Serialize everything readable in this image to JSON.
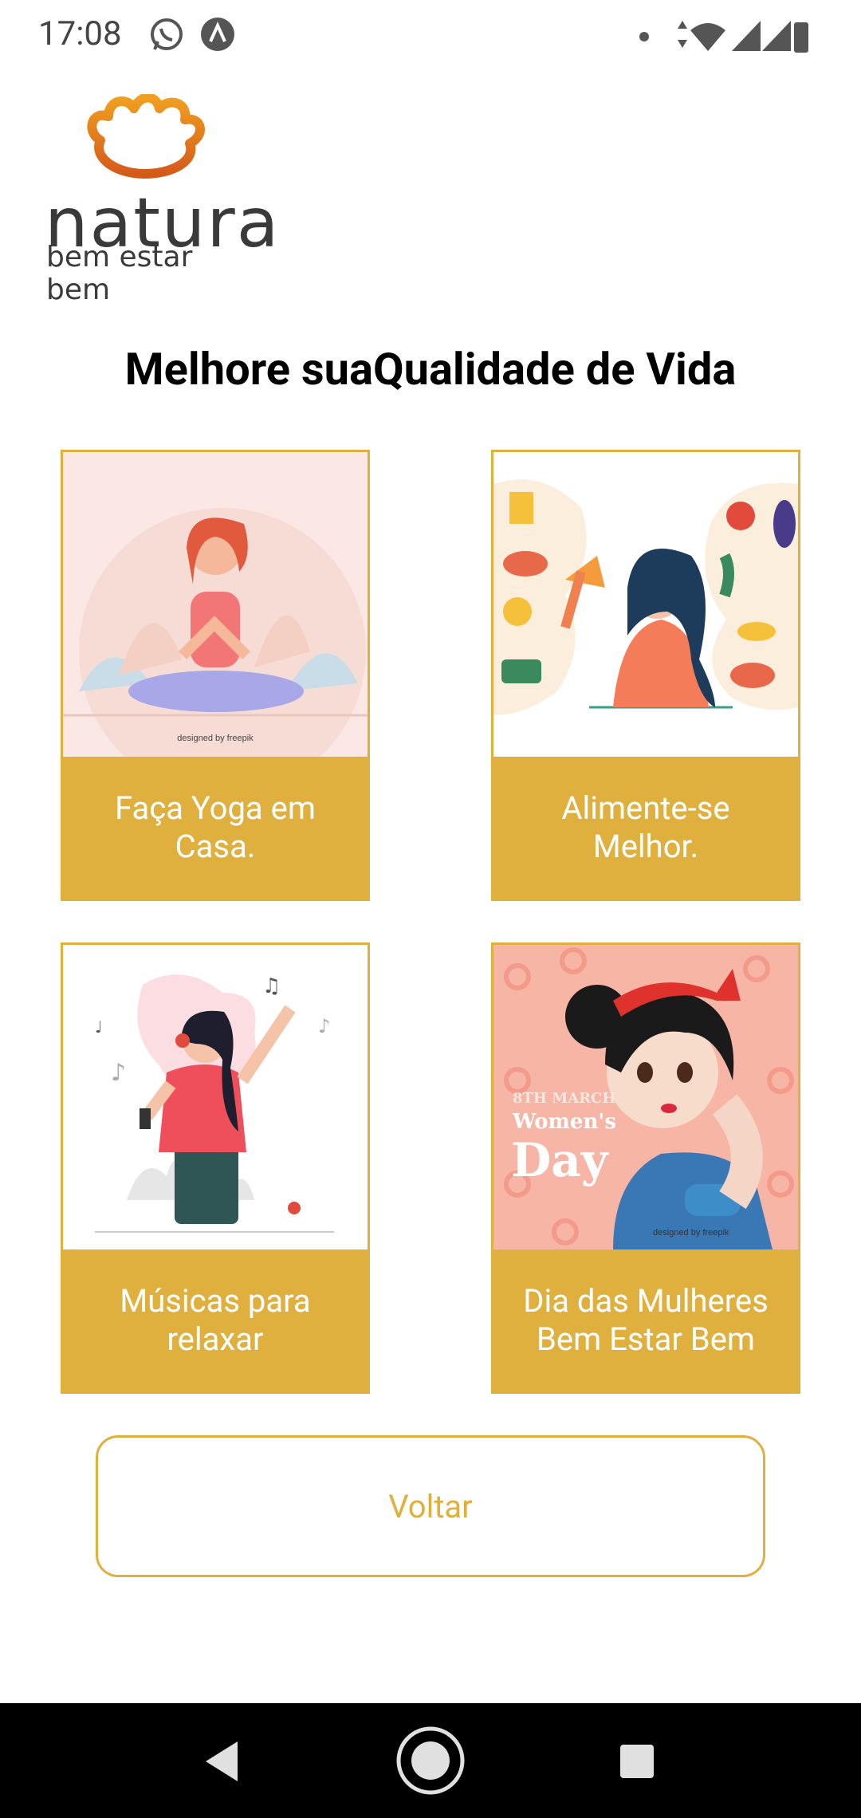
{
  "status": {
    "time": "17:08"
  },
  "brand": {
    "name": "natura",
    "tagline": "bem estar bem"
  },
  "page": {
    "title": "Melhore suaQualidade de Vida"
  },
  "cards": [
    {
      "label": "Faça Yoga em Casa.",
      "icon": "yoga-illustration",
      "credit": "designed by freepik"
    },
    {
      "label": "Alimente-se Melhor.",
      "icon": "healthy-food-illustration"
    },
    {
      "label": "Músicas para relaxar",
      "icon": "music-illustration"
    },
    {
      "label": "Dia das Mulheres Bem Estar Bem",
      "icon": "womens-day-illustration",
      "poster": {
        "line1": "8TH MARCH",
        "line2": "Women's",
        "line3": "Day"
      },
      "credit": "designed by freepik"
    }
  ],
  "actions": {
    "back_label": "Voltar"
  },
  "colors": {
    "accent": "#e0af3c",
    "card_label_bg": "#e0b03f"
  }
}
